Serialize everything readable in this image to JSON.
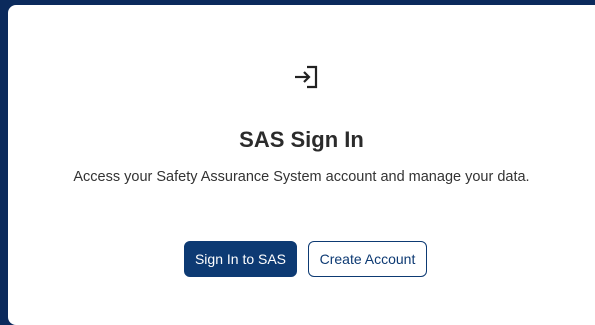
{
  "card": {
    "icon": "sign-in-icon",
    "title": "SAS Sign In",
    "subtitle": "Access your Safety Assurance System account and manage your data.",
    "primary_button_label": "Sign In to SAS",
    "secondary_button_label": "Create Account"
  },
  "colors": {
    "page_background": "#0b2a5c",
    "primary_button": "#0d3a73",
    "title_text": "#2b2b2b"
  }
}
